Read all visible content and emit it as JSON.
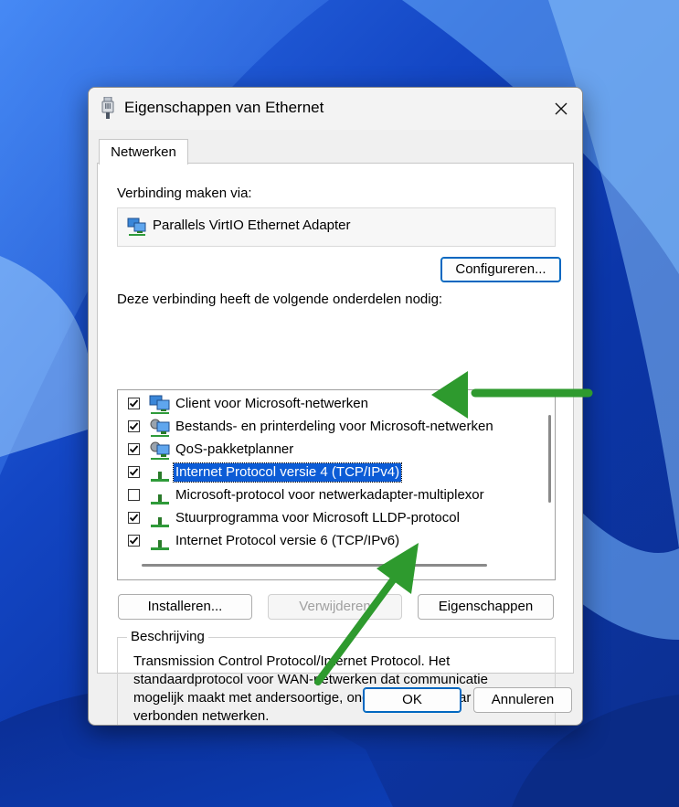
{
  "dialog": {
    "title": "Eigenschappen van Ethernet",
    "tab": "Netwerken",
    "connect_via_label": "Verbinding maken via:",
    "adapter_name": "Parallels VirtIO Ethernet Adapter",
    "configure_button": "Configureren...",
    "components_label": "Deze verbinding heeft de volgende onderdelen nodig:",
    "items": [
      {
        "label": "Client voor Microsoft-netwerken",
        "checked": true,
        "icon": "network-client-icon"
      },
      {
        "label": "Bestands- en printerdeling voor Microsoft-netwerken",
        "checked": true,
        "icon": "network-service-icon"
      },
      {
        "label": "QoS-pakketplanner",
        "checked": true,
        "icon": "network-service-icon"
      },
      {
        "label": "Internet Protocol versie 4 (TCP/IPv4)",
        "checked": true,
        "icon": "protocol-icon",
        "selected": true
      },
      {
        "label": "Microsoft-protocol voor netwerkadapter-multiplexor",
        "checked": false,
        "icon": "protocol-icon"
      },
      {
        "label": "Stuurprogramma voor Microsoft LLDP-protocol",
        "checked": true,
        "icon": "protocol-icon"
      },
      {
        "label": "Internet Protocol versie 6 (TCP/IPv6)",
        "checked": true,
        "icon": "protocol-icon"
      }
    ],
    "install_button": "Installeren...",
    "remove_button": "Verwijderen",
    "properties_button": "Eigenschappen",
    "description_legend": "Beschrijving",
    "description_text": "Transmission Control Protocol/Internet Protocol. Het standaardprotocol voor WAN-netwerken dat communicatie mogelijk maakt met andersoortige, onderling met elkaar verbonden netwerken.",
    "ok_button": "OK",
    "cancel_button": "Annuleren"
  },
  "colors": {
    "selection": "#0c5cd6",
    "arrow": "#2e9a2e",
    "accent_border": "#0067c0"
  }
}
